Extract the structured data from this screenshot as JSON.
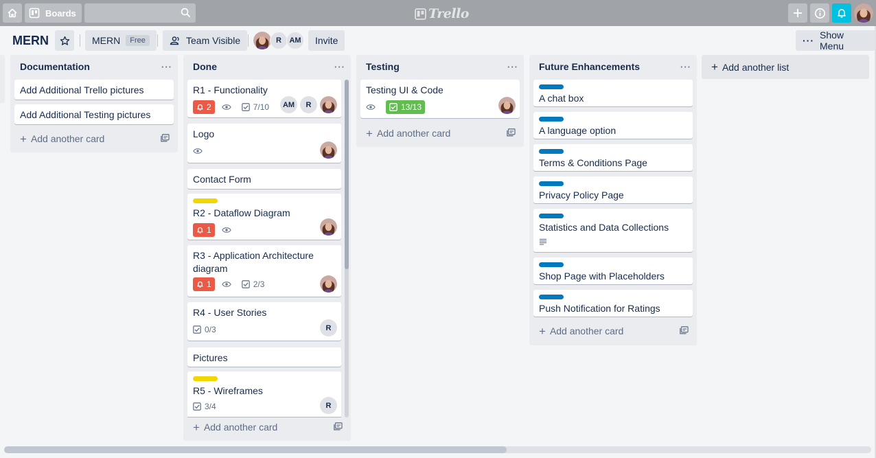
{
  "header": {
    "boards_label": "Boards",
    "search_placeholder": "",
    "logo_text": "Trello"
  },
  "board": {
    "title": "MERN",
    "team_name": "MERN",
    "plan_badge": "Free",
    "visibility": "Team Visible",
    "members": [
      "R",
      "AM"
    ],
    "invite_label": "Invite",
    "show_menu_label": "Show Menu"
  },
  "lists": [
    {
      "title": "Documentation",
      "cards": [
        {
          "title": "Add Additional Trello pictures"
        },
        {
          "title": "Add Additional Testing pictures"
        }
      ],
      "add_card_label": "Add another card"
    },
    {
      "title": "Done",
      "cards": [
        {
          "title": "R1 - Functionality",
          "due": "2",
          "checklist": "7/10",
          "members": [
            "AM",
            "R"
          ]
        },
        {
          "title": "Logo"
        },
        {
          "title": "Contact Form"
        },
        {
          "title": "R2 - Dataflow Diagram",
          "due": "1"
        },
        {
          "title": "R3 - Application Architecture diagram",
          "due": "1",
          "checklist": "2/3"
        },
        {
          "title": "R4 - User Stories",
          "checklist": "0/3",
          "members": [
            "R"
          ]
        },
        {
          "title": "Pictures"
        },
        {
          "title": "R5 - Wireframes",
          "checklist": "3/4",
          "members": [
            "R"
          ]
        }
      ],
      "add_card_label": "Add another card"
    },
    {
      "title": "Testing",
      "cards": [
        {
          "title": "Testing UI & Code",
          "checklist": "13/13"
        }
      ],
      "add_card_label": "Add another card"
    },
    {
      "title": "Future Enhancements",
      "cards": [
        {
          "title": "A chat box"
        },
        {
          "title": "A language option"
        },
        {
          "title": "Terms & Conditions Page"
        },
        {
          "title": "Privacy Policy Page"
        },
        {
          "title": "Statistics and Data Collections"
        },
        {
          "title": "Shop Page with Placeholders"
        },
        {
          "title": "Push Notification for Ratings"
        }
      ],
      "add_card_label": "Add another card"
    }
  ],
  "add_list_label": "Add another list",
  "colors": {
    "header_bg": "#a0a4a9",
    "bell_accent": "#00c2e0",
    "label_yellow": "#f2d600",
    "label_blue": "#0079bf",
    "due_red": "#eb5a46",
    "complete_green": "#61bd4f"
  }
}
